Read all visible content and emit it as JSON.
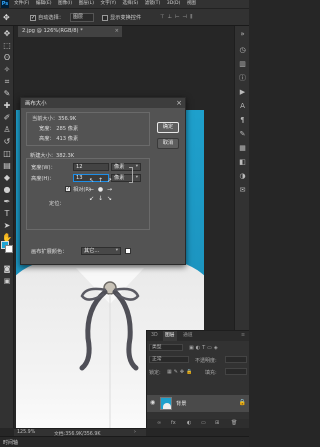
{
  "menubar": {
    "logo": "Ps",
    "items": [
      "文件(F)",
      "编辑(E)",
      "图像(I)",
      "图层(L)",
      "文字(Y)",
      "选择(S)",
      "滤镜(T)",
      "3D(D)",
      "视图"
    ]
  },
  "options": {
    "auto_select_label": "自动选择：",
    "auto_select_value": "图层",
    "transform_label": "显示变换控件"
  },
  "document_tab": {
    "title": "2.jpg @ 126%(RGB/8) *",
    "close": "×"
  },
  "dialog": {
    "title": "画布大小",
    "close": "×",
    "current_size_label": "当前大小：356.9K",
    "current_width": "宽度：   285 像素",
    "current_height": "高度：   413 像素",
    "new_size_label": "新建大小：382.3K",
    "width_label": "宽度(W)：",
    "width_value": "12",
    "width_unit": "像素",
    "height_label": "高度(H)：",
    "height_value": "13",
    "height_unit": "像素",
    "relative_label": "相对(R)",
    "relative_checked": true,
    "anchor_label": "定位：",
    "anchor_arrows": [
      "↖",
      "↑",
      "↗",
      "←",
      "●",
      "→",
      "↙",
      "↓",
      "↘"
    ],
    "ext_color_label": "画布扩展颜色：",
    "ext_color_value": "其它...",
    "ok_label": "确定",
    "cancel_label": "取消"
  },
  "layers_panel": {
    "tabs": [
      "3D",
      "图层",
      "通道"
    ],
    "active_tab": "图层",
    "kind_label": "类型",
    "blend_mode": "正常",
    "opacity_label": "不透明度:",
    "lock_label": "锁定:",
    "fill_label": "填充:",
    "layer_name": "背景",
    "footer_icons": [
      "∞",
      "fx",
      "◐",
      "▭",
      "⊞",
      "🗑"
    ]
  },
  "status": {
    "zoom": "125.9%",
    "doc": "文档:356.9K/356.9K"
  },
  "bottombar": {
    "label": "时间轴"
  },
  "colors": {
    "foreground": "#1fa5d4",
    "background": "#ffffff",
    "accent": "#1c8ee8"
  }
}
